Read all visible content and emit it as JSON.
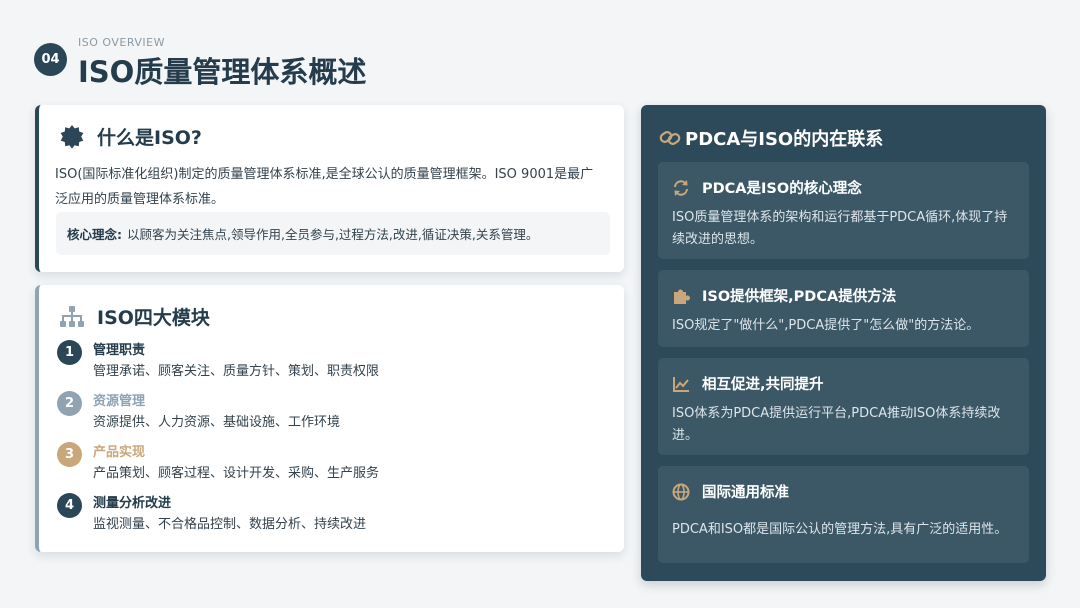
{
  "header": {
    "badge": "04",
    "subtitle": "ISO OVERVIEW",
    "title": "ISO质量管理体系概述"
  },
  "what_is": {
    "title": "什么是ISO?",
    "line1": "ISO(国际标准化组织)制定的质量管理体系标准,是全球公认的质量管理框架。ISO 9001是最广",
    "line2": "泛应用的质量管理体系标准。",
    "core_label": "核心理念:",
    "core_text": "以顾客为关注焦点,领导作用,全员参与,过程方法,改进,循证决策,关系管理。"
  },
  "modules": {
    "title": "ISO四大模块",
    "items": [
      {
        "num": "1",
        "title": "管理职责",
        "desc": "管理承诺、顾客关注、质量方针、策划、职责权限",
        "color": "#2b4656",
        "title_color": "#243c4b"
      },
      {
        "num": "2",
        "title": "资源管理",
        "desc": "资源提供、人力资源、基础设施、工作环境",
        "color": "#8fa3b2",
        "title_color": "#8fa3b2"
      },
      {
        "num": "3",
        "title": "产品实现",
        "desc": "产品策划、顾客过程、设计开发、采购、生产服务",
        "color": "#c9a77a",
        "title_color": "#c9a77a"
      },
      {
        "num": "4",
        "title": "测量分析改进",
        "desc": "监视测量、不合格品控制、数据分析、持续改进",
        "color": "#2b4656",
        "title_color": "#243c4b"
      }
    ]
  },
  "panel": {
    "title": "PDCA与ISO的内在联系",
    "cards": [
      {
        "title": "PDCA是ISO的核心理念",
        "line1": "ISO质量管理体系的架构和运行都基于PDCA循环,体现了持",
        "line2": "续改进的思想。",
        "icon": "refresh-icon"
      },
      {
        "title": "ISO提供框架,PDCA提供方法",
        "line1": "ISO规定了\"做什么\",PDCA提供了\"怎么做\"的方法论。",
        "line2": "",
        "icon": "puzzle-icon"
      },
      {
        "title": "相互促进,共同提升",
        "line1": "ISO体系为PDCA提供运行平台,PDCA推动ISO体系持续改",
        "line2": "进。",
        "icon": "chart-line-icon"
      },
      {
        "title": "国际通用标准",
        "line1": "PDCA和ISO都是国际公认的管理方法,具有广泛的适用性。",
        "line2": "",
        "icon": "globe-icon"
      }
    ]
  },
  "colors": {
    "primary": "#2b4656",
    "accent_gold": "#c9a77a",
    "muted": "#8fa3b2"
  }
}
